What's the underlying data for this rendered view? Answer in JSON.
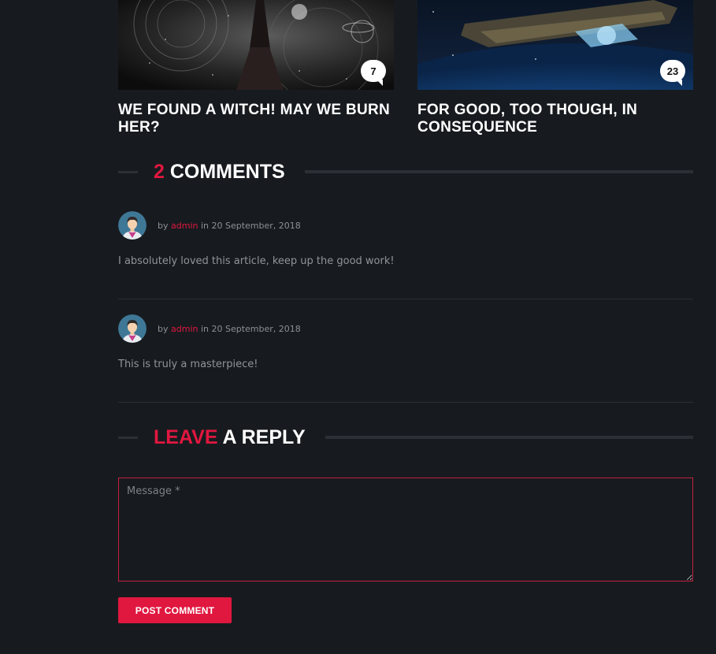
{
  "related_posts": [
    {
      "title": "WE FOUND A WITCH! MAY WE BURN HER?",
      "comment_count": "7",
      "image": "witch-photo"
    },
    {
      "title": "FOR GOOD, TOO THOUGH, IN CONSEQUENCE",
      "comment_count": "23",
      "image": "spaceship-over-planet"
    }
  ],
  "comments_section": {
    "count": "2",
    "label": "COMMENTS",
    "comments": [
      {
        "by": "by",
        "author": "admin",
        "in": "in",
        "date": "20 September, 2018",
        "text": "I absolutely loved this article, keep up the good work!"
      },
      {
        "by": "by",
        "author": "admin",
        "in": "in",
        "date": "20 September, 2018",
        "text": "This is truly a masterpiece!"
      }
    ]
  },
  "reply_section": {
    "title_accent": "LEAVE",
    "title_rest": "A REPLY",
    "message_placeholder": "Message *",
    "message_value": "",
    "submit_label": "POST COMMENT"
  },
  "colors": {
    "background": "#171b1f",
    "accent": "#e0173f",
    "heading": "#ffffff",
    "muted_text": "#8f959b"
  }
}
